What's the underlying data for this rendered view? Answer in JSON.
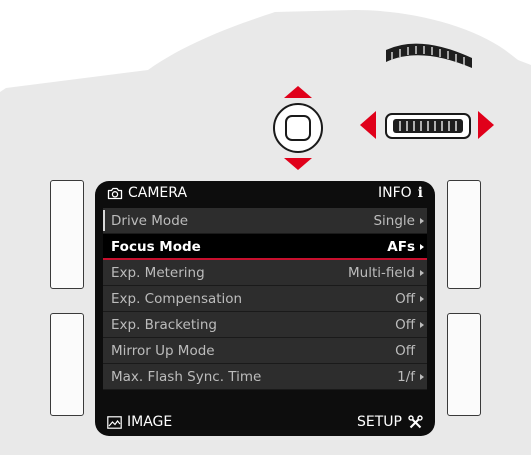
{
  "header": {
    "section": "CAMERA",
    "info_label": "INFO",
    "info_icon": "i"
  },
  "menu": {
    "items": [
      {
        "label": "Drive Mode",
        "value": "Single",
        "chevron": true,
        "selected": false
      },
      {
        "label": "Focus Mode",
        "value": "AFs",
        "chevron": true,
        "selected": true
      },
      {
        "label": "Exp. Metering",
        "value": "Multi-field",
        "chevron": true,
        "selected": false
      },
      {
        "label": "Exp. Compensation",
        "value": "Off",
        "chevron": true,
        "selected": false
      },
      {
        "label": "Exp. Bracketing",
        "value": "Off",
        "chevron": true,
        "selected": false
      },
      {
        "label": "Mirror Up Mode",
        "value": "Off",
        "chevron": false,
        "selected": false
      },
      {
        "label": "Max. Flash Sync. Time",
        "value": "1/f",
        "chevron": true,
        "selected": false
      }
    ]
  },
  "footer": {
    "left_label": "IMAGE",
    "right_label": "SETUP"
  },
  "icons": {
    "header_left": "camera-icon",
    "footer_left": "image-icon",
    "footer_right": "setup-tools-icon",
    "dpad": "dpad-icon",
    "thumbwheel": "thumbwheel-icon"
  },
  "colors": {
    "accent_red": "#e0001a",
    "body": "#eaeaea",
    "screen": "#0d0d0d",
    "selection_underline": "#c8102e"
  }
}
